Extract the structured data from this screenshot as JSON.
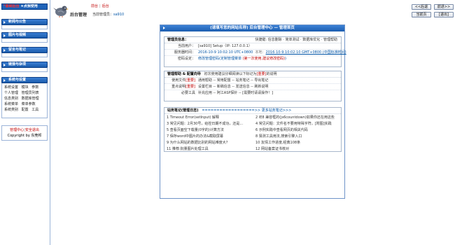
{
  "brand": {
    "label_red": "*基础后台",
    "label_white": "★点我使用"
  },
  "sidebar": {
    "sections": [
      {
        "title": "新闻与公告",
        "items": []
      },
      {
        "title": "图片与视频",
        "items": []
      },
      {
        "title": "留言与笔记",
        "items": []
      },
      {
        "title": "链接与杂项",
        "items": []
      },
      {
        "title": "系统与设置",
        "items": [
          "系统设置",
          "模块",
          "参数",
          "个人管理",
          "管理员列表",
          "信息类别",
          "数据库管理",
          "系统菜单",
          "菜单参数",
          "系统类别",
          "配置",
          "工具"
        ]
      }
    ],
    "tools": {
      "link_home": "管理中心",
      "sep": "|",
      "link_logout": "安全退出",
      "copyright": "Copyright by 东莞邦"
    }
  },
  "header": {
    "logo_text": "后台管理",
    "admin_prefix": "当前管理员：",
    "admin_name": "sa910",
    "top_links": [
      "前台",
      "后台"
    ],
    "buttons": {
      "back": "<<后退",
      "forward": "前进>>",
      "current": "当前页",
      "logout": "[退出]"
    }
  },
  "main": {
    "title": "(请填写您的网站名称) 后台管理中心 — 管理首页",
    "info": {
      "head": "管理员信息：",
      "quick": "快捷键: 信息删除 · 简单测试 · 数据库优化 · 管理帮助",
      "rows": [
        {
          "label": "当前用户：",
          "value": "[sa910] Setup（IP: 127.0.0.1）"
        },
        {
          "label": "服务器时间：",
          "value": "2016-10-9 10:02:10 UTC+0800",
          "extra_gray": "本地：",
          "extra_link": "2016-10-9 10:02:10 GMT+0800 (中国标准时间)"
        },
        {
          "label": "密码设定：",
          "value": "修改管理密码(定制管理菜单 ",
          "red": "(第一次使用,建议修改密码)",
          "tail": ")"
        }
      ]
    },
    "help": {
      "head": "管理帮助 & 配置向导",
      "note_pre": "初次使用建议仔细阅读以下标记为",
      "note_red": "[重要]",
      "note_post": "的说明",
      "rows": [
        {
          "label": "使用文件",
          "label_red": "[重要]",
          "value": "通用帮助 -- 常用配置 -- 站务笔记 -- 导出笔记"
        },
        {
          "label": "重点说明",
          "label_red": "[重要]",
          "value": "设置栏目 -- 新稿信息 -- 发送信息 -- 刷新说明"
        },
        {
          "label": "必要工具",
          "label_red": "",
          "value": "补充应用 -- 阿江ASP探针 -- [需要时请请操作！]"
        }
      ]
    },
    "notes": {
      "head": "站务笔记(管理日志)",
      "more": "==================>> 更多站务笔记>>>",
      "items": [
        "1  Timeout Error(setInput) 解释",
        "2  IE8 兼容框的(js6countdown)如果你还在用这些",
        "3  常见问题：2月30号，给控日期不成功，还是...",
        "4  常见问题：文件名不要用特殊字符。[附图]实践",
        "5  查看页面空下载量(0字的)计算方法",
        "6  示例实践中查看网页的相关代码",
        "7  保存word中图片的办法&截取屏幕",
        "8  猜测工具用法,搜索引擎入口",
        "9  为什么网站的数据比别的网站难度大?",
        "10  友情工作进度,经典108条",
        "11  推荐:批量图片处理工具",
        "12  网站备案证书核对"
      ]
    }
  }
}
